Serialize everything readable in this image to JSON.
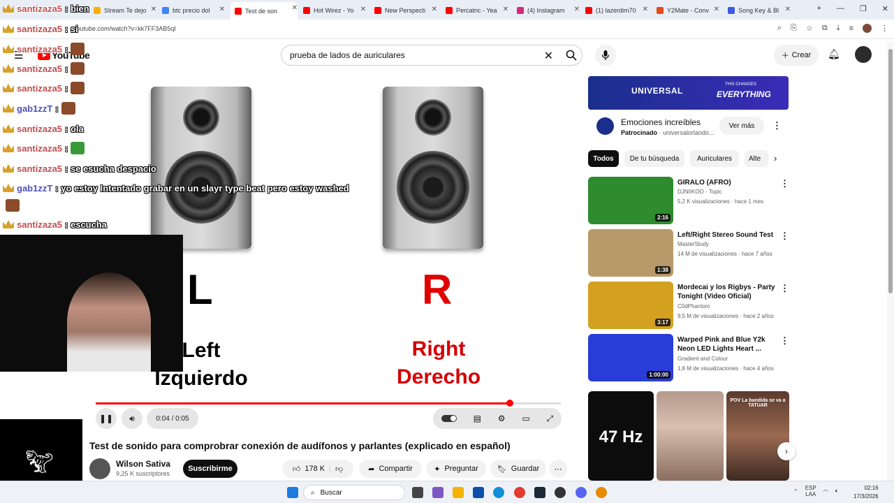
{
  "browser": {
    "tabs": [
      {
        "label": "Stream Te dejo",
        "color": "#ffb000"
      },
      {
        "label": "btc precio dol",
        "color": "#4285f4"
      },
      {
        "label": "Test de son",
        "color": "#ff0000",
        "active": true
      },
      {
        "label": "Hot Wirez - Yo",
        "color": "#ff0000"
      },
      {
        "label": "New Perspecti",
        "color": "#ff0000"
      },
      {
        "label": "Percatric - Yea",
        "color": "#ff0000"
      },
      {
        "label": "(4) Instagram",
        "color": "#d62976"
      },
      {
        "label": "(1) lazerdim70",
        "color": "#ff0000"
      },
      {
        "label": "Y2Mate - Conv",
        "color": "#e64a19"
      },
      {
        "label": "Song Key & Bl",
        "color": "#3b5bdb"
      }
    ],
    "url": "youtube.com/watch?v=kk7FF3AB5qI"
  },
  "header": {
    "logo_text": "YouTube",
    "search_value": "prueba de lados de auriculares",
    "create_label": "Crear"
  },
  "player": {
    "left_letter": "L",
    "right_letter": "R",
    "left_label": "Left",
    "left_label_es": "Izquierdo",
    "right_label": "Right",
    "right_label_es": "Derecho",
    "time": "0:04 / 0:05",
    "progress_fraction": 0.89
  },
  "video": {
    "title": "Test de sonido para comprobrar conexión de audífonos y parlantes (explicado en español)",
    "channel": "Wilson Sativa",
    "subscribers": "9,25 K suscriptores",
    "subscribe_label": "Suscribirme",
    "likes": "178 K",
    "share_label": "Compartir",
    "ask_label": "Preguntar",
    "save_label": "Guardar"
  },
  "ad": {
    "brand": "UNIVERSAL",
    "tag_small": "THIS CHANGES",
    "tag_big": "EVERYTHING",
    "title": "Emociones increíbles",
    "sponsored": "Patrocinado",
    "advertiser": "universalorlando...",
    "cta": "Ver más"
  },
  "chips": [
    "Todos",
    "De tu búsqueda",
    "Auriculares",
    "Alte"
  ],
  "recommendations": [
    {
      "title": "GIRALO (AFRO)",
      "channel": "DJNIIKOO - Topic",
      "meta": "5,2 K visualizaciones · hace 1 mes",
      "duration": "2:16",
      "thumb": "#2e8b2e"
    },
    {
      "title": "Left/Right Stereo Sound Test",
      "channel": "MasterStudy",
      "meta": "14 M de visualizaciones · hace 7 años",
      "duration": "1:38",
      "thumb": "#b89a6a"
    },
    {
      "title": "Mordecai y los Rigbys - Party Tonight (Video Oficial)",
      "channel": "C0dPhantom",
      "meta": "9,5 M de visualizaciones · hace 2 años",
      "duration": "3:17",
      "thumb": "#d4a020"
    },
    {
      "title": "Warped Pink and Blue Y2k Neon LED Lights Heart ...",
      "channel": "Gradient and Colour",
      "meta": "1,8 M de visualizaciones · hace 4 años",
      "duration": "1:00:00",
      "thumb": "#2a3cd8"
    }
  ],
  "shorts": [
    {
      "text": "47 Hz"
    },
    {
      "text": ""
    },
    {
      "text": "POV La bandida se va a TATUAR"
    }
  ],
  "chat": [
    {
      "user": "santizaza5",
      "msg": ": bien",
      "blue": false,
      "emote": ""
    },
    {
      "user": "santizaza5",
      "msg": ": si",
      "blue": false,
      "emote": ""
    },
    {
      "user": "santizaza5",
      "msg": ":",
      "blue": false,
      "emote": "#8b4a2a"
    },
    {
      "user": "santizaza5",
      "msg": ":",
      "blue": false,
      "emote": "#8b4a2a"
    },
    {
      "user": "santizaza5",
      "msg": ":",
      "blue": false,
      "emote": "#8b4a2a"
    },
    {
      "user": "gab1zzT",
      "msg": ":",
      "blue": true,
      "emote": "#8b4a2a"
    },
    {
      "user": "santizaza5",
      "msg": ": ola",
      "blue": false,
      "emote": ""
    },
    {
      "user": "santizaza5",
      "msg": ":",
      "blue": false,
      "emote": "#3a9a3a"
    },
    {
      "user": "santizaza5",
      "msg": ": se esucha despacio",
      "blue": false,
      "emote": ""
    },
    {
      "user": "gab1zzT",
      "msg": ": yo estoy Intentado grabar en un slayr type beat pero estoy washed",
      "blue": true,
      "emote": ""
    },
    {
      "user": "",
      "msg": "",
      "blue": false,
      "emote": "#8b4a2a"
    },
    {
      "user": "santizaza5",
      "msg": ": escucha",
      "blue": false,
      "emote": ""
    }
  ],
  "taskbar": {
    "search_label": "Buscar",
    "lang": "ESP",
    "lang2": "LAA",
    "time": "02:16",
    "date": "17/3/2026"
  }
}
